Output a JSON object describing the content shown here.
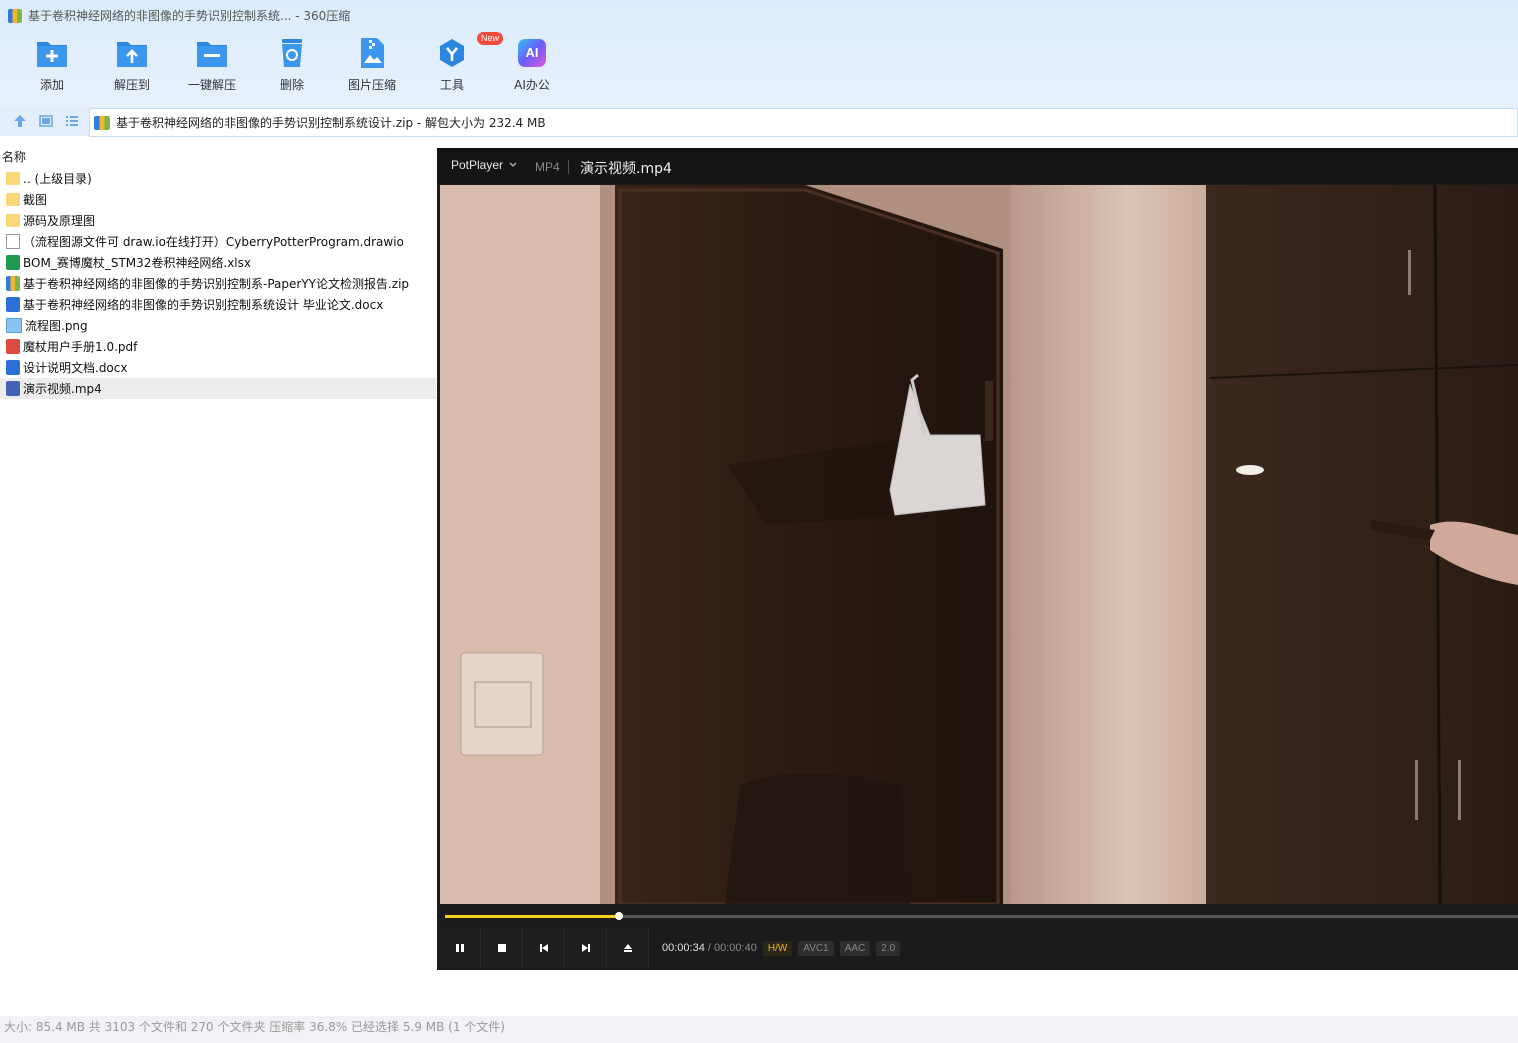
{
  "window": {
    "title": "基于卷积神经网络的非图像的手势识别控制系统... - 360压缩"
  },
  "toolbar": [
    {
      "label": "添加",
      "icon": "add-icon"
    },
    {
      "label": "解压到",
      "icon": "extract-to-icon"
    },
    {
      "label": "一键解压",
      "icon": "one-click-extract-icon"
    },
    {
      "label": "删除",
      "icon": "delete-icon"
    },
    {
      "label": "图片压缩",
      "icon": "image-compress-icon"
    },
    {
      "label": "工具",
      "icon": "tools-icon",
      "badge": "New"
    },
    {
      "label": "AI办公",
      "icon": "ai-office-icon",
      "glyph": "AI"
    }
  ],
  "address": {
    "path": "基于卷积神经网络的非图像的手势识别控制系统设计.zip - 解包大小为 232.4 MB"
  },
  "list": {
    "header": "名称",
    "items": [
      {
        "name": ".. (上级目录)",
        "type": "folder"
      },
      {
        "name": "截图",
        "type": "folder"
      },
      {
        "name": "源码及原理图",
        "type": "folder"
      },
      {
        "name": "（流程图源文件可 draw.io在线打开）CyberryPotterProgram.drawio",
        "type": "doc"
      },
      {
        "name": "BOM_赛博魔杖_STM32卷积神经网络.xlsx",
        "type": "xlsx"
      },
      {
        "name": "基于卷积神经网络的非图像的手势识别控制系-PaperYY论文检测报告.zip",
        "type": "zip"
      },
      {
        "name": "基于卷积神经网络的非图像的手势识别控制系统设计 毕业论文.docx",
        "type": "word"
      },
      {
        "name": "流程图.png",
        "type": "png"
      },
      {
        "name": "魔杖用户手册1.0.pdf",
        "type": "pdf"
      },
      {
        "name": "设计说明文档.docx",
        "type": "word"
      },
      {
        "name": "演示视频.mp4",
        "type": "mp4",
        "selected": true
      }
    ]
  },
  "status": {
    "text": "大小: 85.4 MB 共 3103 个文件和 270 个文件夹 压缩率 36.8% 已经选择 5.9 MB (1 个文件)"
  },
  "player": {
    "app": "PotPlayer",
    "format": "MP4",
    "filename": "演示视频.mp4",
    "current_time": "00:00:34",
    "separator": "/",
    "total_time": "00:00:40",
    "progress": 0.162,
    "tags": [
      "H/W",
      "AVC1",
      "AAC",
      "2.0"
    ]
  },
  "colors": {
    "accent_blue": "#2a86e0",
    "seek_yellow": "#f5d019",
    "badge_red": "#f04a3c"
  }
}
